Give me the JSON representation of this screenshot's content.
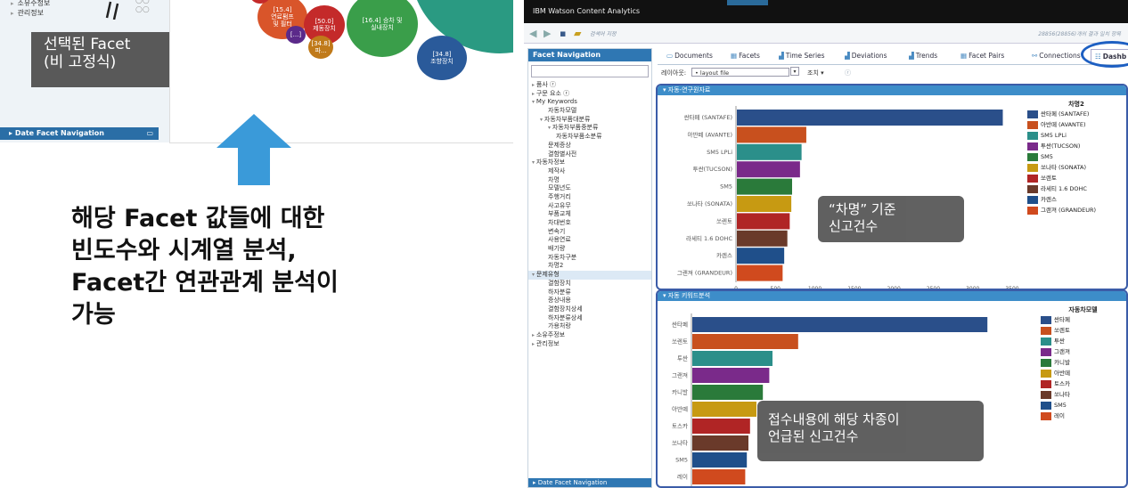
{
  "left_panel": {
    "items": [
      "소유주정보",
      "관리정보"
    ],
    "facet_label": "선택된 Facet\n(비 고정식)",
    "date_facet_nav": "Date Facet Navigation"
  },
  "clusters": [
    {
      "label": "[15.4]\n연료펌프\n및 필터",
      "color": "#d9552a"
    },
    {
      "label": "[50.0]\n제동장치",
      "color": "#c42a2a"
    },
    {
      "label": "[16.4] 승차 및\n실내장치",
      "color": "#3a9e4a"
    },
    {
      "label": "[...]",
      "color": "#5b2a8a"
    },
    {
      "label": "[34.8]\n파...",
      "color": "#c07a1a"
    },
    {
      "label": "[34.8]\n조향장치",
      "color": "#2a5a9a"
    }
  ],
  "headline": "해당 Facet 값들에 대한\n빈도수와 시계열 분석,\nFacet간 연관관계 분석이\n가능",
  "app": {
    "title": "IBM Watson Content Analytics",
    "search_link": "검색어 지정",
    "count_text": "28856(28856)개의 결과 일치 항목",
    "nav_title": "Facet Navigation",
    "nav_items": [
      {
        "label": "품사 ⓡ",
        "indent": 0,
        "tri": "▸"
      },
      {
        "label": "구문 요소 ⓡ",
        "indent": 0,
        "tri": "▸"
      },
      {
        "label": "My Keywords",
        "indent": 0,
        "tri": "▾"
      },
      {
        "label": "자동차모델",
        "indent": 2,
        "tri": ""
      },
      {
        "label": "자동차부품대분류",
        "indent": 1,
        "tri": "▾"
      },
      {
        "label": "자동차부품중분류",
        "indent": 2,
        "tri": "▾"
      },
      {
        "label": "자동차부품소분류",
        "indent": 3,
        "tri": ""
      },
      {
        "label": "문제증상",
        "indent": 2,
        "tri": ""
      },
      {
        "label": "결함별사전",
        "indent": 2,
        "tri": ""
      },
      {
        "label": "자동차정보",
        "indent": 0,
        "tri": "▾"
      },
      {
        "label": "제작사",
        "indent": 2,
        "tri": ""
      },
      {
        "label": "차명",
        "indent": 2,
        "tri": ""
      },
      {
        "label": "모델년도",
        "indent": 2,
        "tri": ""
      },
      {
        "label": "주행거리",
        "indent": 2,
        "tri": ""
      },
      {
        "label": "사고유무",
        "indent": 2,
        "tri": ""
      },
      {
        "label": "부품교체",
        "indent": 2,
        "tri": ""
      },
      {
        "label": "차대번호",
        "indent": 2,
        "tri": ""
      },
      {
        "label": "변속기",
        "indent": 2,
        "tri": ""
      },
      {
        "label": "사용연료",
        "indent": 2,
        "tri": ""
      },
      {
        "label": "배기량",
        "indent": 2,
        "tri": ""
      },
      {
        "label": "자동차구분",
        "indent": 2,
        "tri": ""
      },
      {
        "label": "차명2",
        "indent": 2,
        "tri": ""
      },
      {
        "label": "문제유형",
        "indent": 0,
        "tri": "▾",
        "highlight": true
      },
      {
        "label": "결함장치",
        "indent": 2,
        "tri": ""
      },
      {
        "label": "하자분류",
        "indent": 2,
        "tri": ""
      },
      {
        "label": "증상내용",
        "indent": 2,
        "tri": ""
      },
      {
        "label": "결함장치상세",
        "indent": 2,
        "tri": ""
      },
      {
        "label": "하자분류상세",
        "indent": 2,
        "tri": ""
      },
      {
        "label": "가용처랑",
        "indent": 2,
        "tri": ""
      },
      {
        "label": "소유주정보",
        "indent": 0,
        "tri": "▸"
      },
      {
        "label": "관리정보",
        "indent": 0,
        "tri": "▸"
      }
    ],
    "nav_footer": "Date Facet Navigation",
    "tabs": [
      "Documents",
      "Facets",
      "Time Series",
      "Deviations",
      "Trends",
      "Facet Pairs",
      "Connections",
      "Dashb"
    ],
    "layout_label": "레이아웃:",
    "layout_value": "• layout file",
    "query_label": "조치 ▾",
    "widget1_title": "자동-연구원자료",
    "widget2_title": "자동 키워드분석",
    "caption1": "“차명” 기준\n신고건수",
    "caption2": "접수내용에 해당 차종이\n언급된 신고건수"
  },
  "chart_data": [
    {
      "type": "bar",
      "orientation": "horizontal",
      "title": "",
      "legend_title": "차명2",
      "categories": [
        "싼타페 (SANTAFE)",
        "아반떼 (AVANTE)",
        "SM5 LPLi",
        "투싼(TUCSON)",
        "SM5",
        "쏘나타 (SONATA)",
        "쏘렌토",
        "라세티 1.6 DOHC",
        "카렌스",
        "그랜져 (GRANDEUR)"
      ],
      "values": [
        3370,
        880,
        820,
        800,
        700,
        690,
        670,
        640,
        600,
        580
      ],
      "colors": [
        "#2a4f8a",
        "#c8501e",
        "#2b8f8a",
        "#7a2a8a",
        "#2a7a3a",
        "#c79a12",
        "#b02525",
        "#6a3a2a",
        "#1f4f8a",
        "#d04a1e"
      ],
      "xticks": [
        0,
        500,
        1000,
        1500,
        2000,
        2500,
        3000,
        3500
      ],
      "xlim": [
        0,
        3500
      ]
    },
    {
      "type": "bar",
      "orientation": "horizontal",
      "title": "",
      "legend_title": "자동차모델",
      "categories": [
        "싼타페",
        "쏘렌토",
        "투싼",
        "그랜져",
        "카니발",
        "아반떼",
        "토스카",
        "쏘나타",
        "SM5",
        "레이"
      ],
      "values": [
        920,
        330,
        250,
        240,
        220,
        200,
        180,
        175,
        170,
        165
      ],
      "colors": [
        "#2a4f8a",
        "#c8501e",
        "#2b8f8a",
        "#7a2a8a",
        "#2a7a3a",
        "#c79a12",
        "#b02525",
        "#6a3a2a",
        "#1f4f8a",
        "#d04a1e"
      ],
      "xticks": [
        0,
        100,
        200,
        300,
        400,
        500,
        600,
        700,
        800,
        900,
        1000
      ],
      "xlim": [
        0,
        1000
      ]
    }
  ]
}
